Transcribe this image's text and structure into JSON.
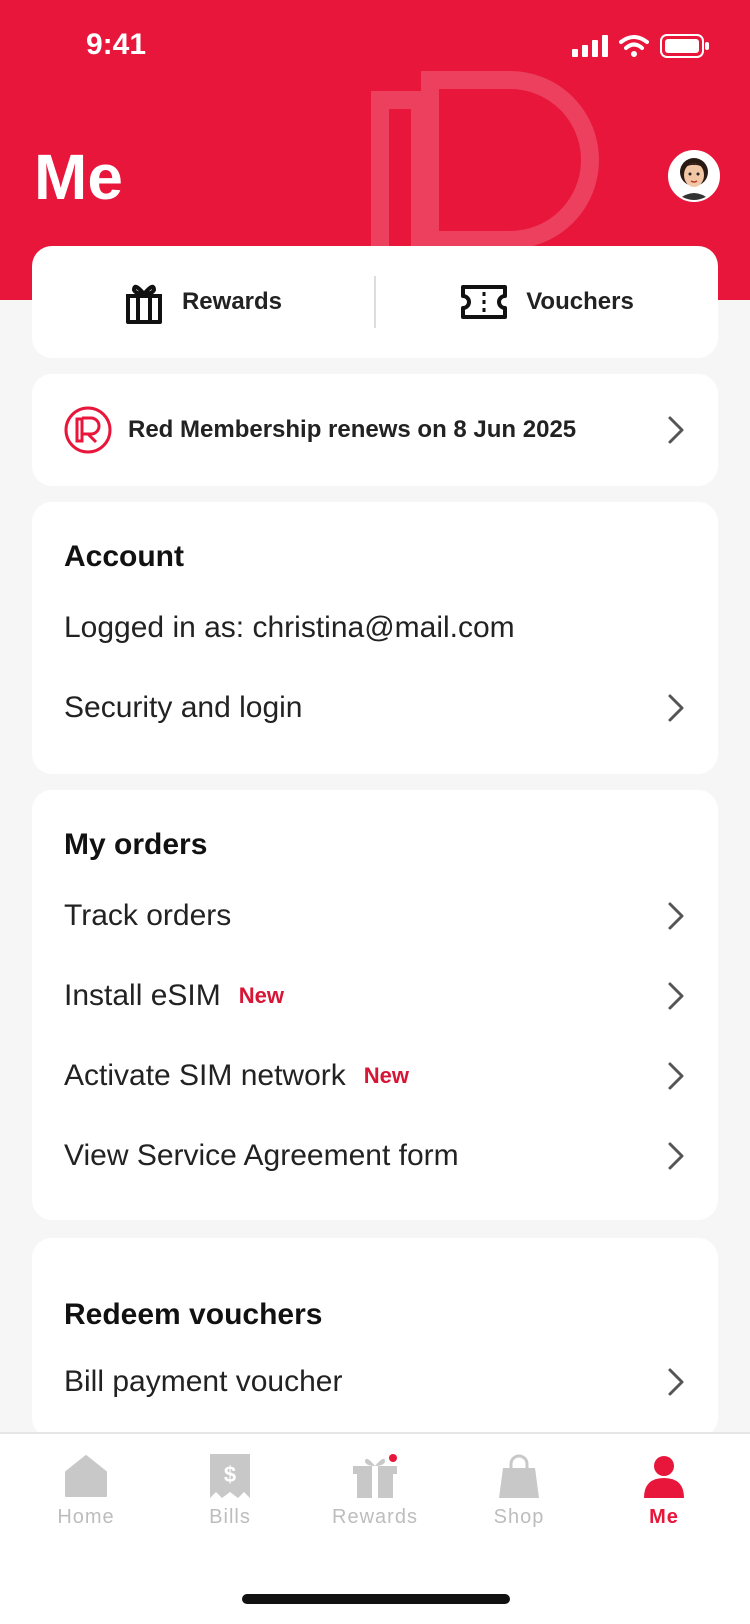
{
  "status": {
    "time": "9:41"
  },
  "header": {
    "title": "Me"
  },
  "quick_actions": {
    "rewards": "Rewards",
    "vouchers": "Vouchers"
  },
  "membership": {
    "text": "Red Membership renews on 8 Jun 2025"
  },
  "account": {
    "title": "Account",
    "logged_in": "Logged in as: christina@mail.com",
    "security": "Security and login"
  },
  "orders": {
    "title": "My orders",
    "items": [
      {
        "label": "Track orders",
        "badge": ""
      },
      {
        "label": "Install eSIM",
        "badge": "New"
      },
      {
        "label": "Activate SIM network",
        "badge": "New"
      },
      {
        "label": "View Service Agreement form",
        "badge": ""
      }
    ]
  },
  "redeem": {
    "title": "Redeem vouchers",
    "items": [
      {
        "label": "Bill payment voucher"
      }
    ]
  },
  "tabbar": {
    "items": [
      {
        "label": "Home"
      },
      {
        "label": "Bills"
      },
      {
        "label": "Rewards"
      },
      {
        "label": "Shop"
      },
      {
        "label": "Me"
      }
    ]
  },
  "colors": {
    "brand": "#e8163a",
    "inactive": "#bdbdbd"
  }
}
